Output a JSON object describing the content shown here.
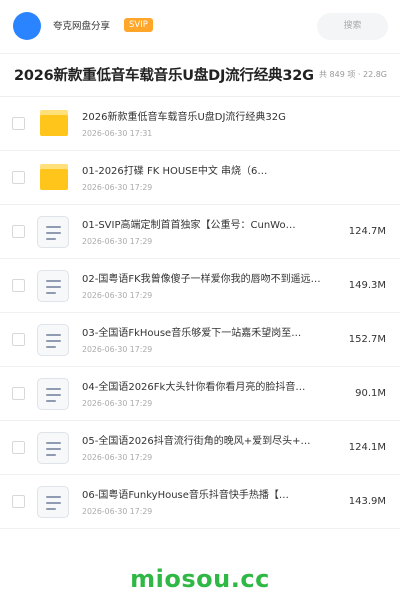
{
  "header": {
    "brand": "夸克网盘分享",
    "badge": "SVIP",
    "search_label": "搜索"
  },
  "folder_title": "2026新款重低音车载音乐U盘DJ流行经典32G",
  "folder_meta": "共 849 项 · 22.8G",
  "items": [
    {
      "type": "folder",
      "name": "2026新款重低音车载音乐U盘DJ流行经典32G",
      "date": "2026-06-30 17:31",
      "size": ""
    },
    {
      "type": "folder",
      "name": "01-2026打碟 FK HOUSE中文 串烧（6…",
      "date": "2026-06-30 17:29",
      "size": ""
    },
    {
      "type": "file",
      "name": "01-SVIP高端定制首首独家【公重号：CunWo…",
      "date": "2026-06-30 17:29",
      "size": "124.7M"
    },
    {
      "type": "file",
      "name": "02-国粤语FK我曾像傻子一样爱你我的唇吻不到遥远…",
      "date": "2026-06-30 17:29",
      "size": "149.3M"
    },
    {
      "type": "file",
      "name": "03-全国语FkHouse音乐够爱下一站嘉禾望岗至…",
      "date": "2026-06-30 17:29",
      "size": "152.7M"
    },
    {
      "type": "file",
      "name": "04-全国语2026Fk大头针你看你看月亮的脸抖音…",
      "date": "2026-06-30 17:29",
      "size": "90.1M"
    },
    {
      "type": "file",
      "name": "05-全国语2026抖音流行街角的晚风+爱到尽头+…",
      "date": "2026-06-30 17:29",
      "size": "124.1M"
    },
    {
      "type": "file",
      "name": "06-国粤语FunkyHouse音乐抖音快手热播【…",
      "date": "2026-06-30 17:29",
      "size": "143.9M"
    }
  ],
  "watermark": "miosou.cc",
  "colors": {
    "accent": "#2b84ff",
    "svip": "#ffa62b",
    "folder": "#ffc51a",
    "watermark": "#2fb843"
  },
  "icons": {
    "folder": "folder-icon",
    "file": "document-icon"
  }
}
